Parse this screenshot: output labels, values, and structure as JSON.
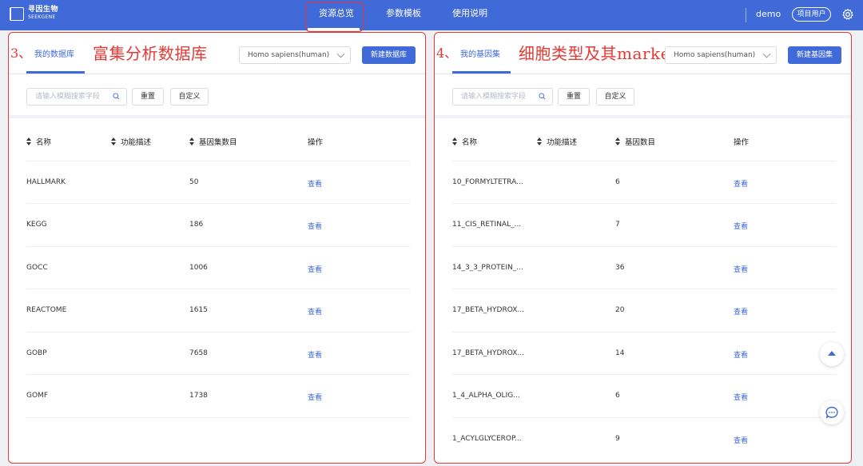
{
  "nav": {
    "logo_cn": "寻因生物",
    "logo_en": "SEEKGENE",
    "items": [
      "资源总览",
      "参数模板",
      "使用说明"
    ],
    "user": "demo",
    "role": "项目用户"
  },
  "left": {
    "annotation_num": "3、",
    "annotation": "富集分析数据库",
    "tab": "我的数据库",
    "species": "Homo sapiens(human)",
    "new_button": "新建数据库",
    "search_placeholder": "请输入模糊搜索字段",
    "reset": "重置",
    "custom": "自定义",
    "columns": [
      "名称",
      "功能描述",
      "基因集数目",
      "操作"
    ],
    "rows": [
      {
        "name": "HALLMARK",
        "count": "50",
        "action": "查看"
      },
      {
        "name": "KEGG",
        "count": "186",
        "action": "查看"
      },
      {
        "name": "GOCC",
        "count": "1006",
        "action": "查看"
      },
      {
        "name": "REACTOME",
        "count": "1615",
        "action": "查看"
      },
      {
        "name": "GOBP",
        "count": "7658",
        "action": "查看"
      },
      {
        "name": "GOMF",
        "count": "1738",
        "action": "查看"
      }
    ]
  },
  "right": {
    "annotation_num": "4、",
    "annotation": "细胞类型及其marker",
    "tab": "我的基因集",
    "species": "Homo sapiens(human)",
    "new_button": "新建基因集",
    "search_placeholder": "请输入模糊搜索字段",
    "reset": "重置",
    "custom": "自定义",
    "columns": [
      "名称",
      "功能描述",
      "基因数目",
      "操作"
    ],
    "rows": [
      {
        "name": "10_FORMYLTETRA...",
        "count": "6",
        "action": "查看"
      },
      {
        "name": "11_CIS_RETINAL_...",
        "count": "7",
        "action": "查看"
      },
      {
        "name": "14_3_3_PROTEIN_...",
        "count": "36",
        "action": "查看"
      },
      {
        "name": "17_BETA_HYDROX...",
        "count": "20",
        "action": "查看"
      },
      {
        "name": "17_BETA_HYDROX...",
        "count": "14",
        "action": "查看"
      },
      {
        "name": "1_4_ALPHA_OLIG...",
        "count": "6",
        "action": "查看"
      },
      {
        "name": "1_ACYLGLYCEROP...",
        "count": "9",
        "action": "查看"
      }
    ]
  },
  "colors": {
    "primary": "#3f6ad8",
    "annotation": "#e53935"
  },
  "icons": [
    "logo-icon",
    "gear-icon",
    "search-icon",
    "sort-icon",
    "scroll-top-icon",
    "chat-icon"
  ]
}
